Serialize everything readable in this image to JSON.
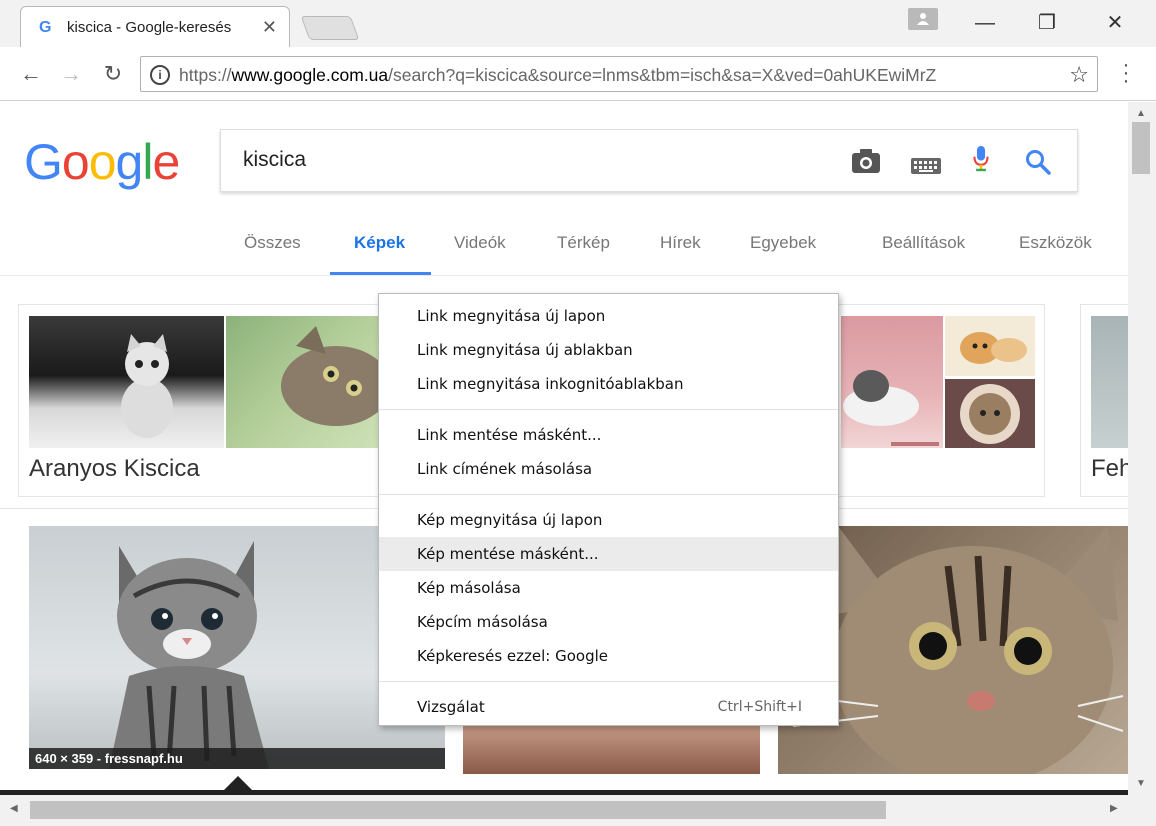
{
  "browser": {
    "tab_title": "kiscica - Google-keresés",
    "tab_favicon": "G",
    "close_glyph": "✕",
    "url_scheme": "https://",
    "url_host": "www.google.com.ua",
    "url_path": "/search?q=kiscica&source=lnms&tbm=isch&sa=X&ved=0ahUKEwiMrZ",
    "window_buttons": {
      "minimize": "—",
      "restore": "❐",
      "close": "✕"
    }
  },
  "google": {
    "logo_letters": [
      "G",
      "o",
      "o",
      "g",
      "l",
      "e"
    ],
    "query": "kiscica",
    "tabs": [
      "Összes",
      "Képek",
      "Videók",
      "Térkép",
      "Hírek",
      "Egyebek",
      "Beállítások",
      "Eszközök"
    ],
    "active_tab": "Képek"
  },
  "results": {
    "card_captions": [
      "Aranyos Kiscica",
      "Feh"
    ],
    "image_meta": "640 × 359 - fressnapf.hu"
  },
  "context_menu": {
    "groups": [
      [
        "Link megnyitása új lapon",
        "Link megnyitása új ablakban",
        "Link megnyitása inkognitóablakban"
      ],
      [
        "Link mentése másként...",
        "Link címének másolása"
      ],
      [
        "Kép megnyitása új lapon",
        "Kép mentése másként...",
        "Kép másolása",
        "Képcím másolása",
        "Képkeresés ezzel: Google"
      ],
      [
        "Vizsgálat"
      ]
    ],
    "hovered_item": "Kép mentése másként...",
    "inspect_shortcut": "Ctrl+Shift+I"
  },
  "icons": [
    "google-favicon-icon",
    "profile-icon",
    "back-icon",
    "forward-icon",
    "reload-icon",
    "info-icon",
    "star-icon",
    "menu-dots-icon",
    "camera-icon",
    "keyboard-icon",
    "microphone-icon",
    "search-icon"
  ],
  "colors": {
    "accent_blue": "#4285f4",
    "active_tab": "#1a73e8"
  }
}
